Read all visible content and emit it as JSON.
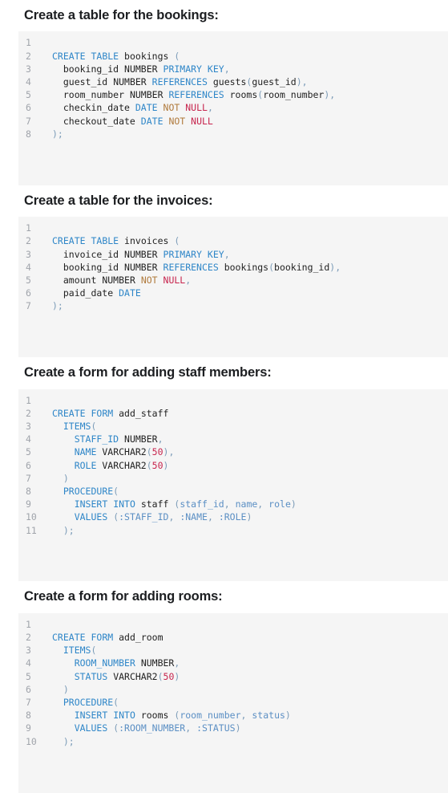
{
  "theme": {
    "page_background": "#ffffff",
    "code_background": "#f5f5f5",
    "heading_color": "#1c1e21",
    "line_number_color": "#a0a4ab",
    "keyword_color": "#2e86c8",
    "null_color": "#c7254e",
    "not_color": "#b07a3c",
    "number_color": "#c7254e",
    "punctuation_color": "#7c9cb8",
    "identifier_color": "#222222"
  },
  "sections": [
    {
      "heading": "Create a table for the bookings:",
      "language": "sql",
      "line_numbers": [
        "1",
        "2",
        "3",
        "4",
        "5",
        "6",
        "7",
        "8"
      ],
      "code": "CREATE TABLE bookings (\n  booking_id NUMBER PRIMARY KEY,\n  guest_id NUMBER REFERENCES guests(guest_id),\n  room_number NUMBER REFERENCES rooms(room_number),\n  checkin_date DATE NOT NULL,\n  checkout_date DATE NOT NULL\n);\n",
      "lines": [
        "CREATE TABLE bookings (",
        "  booking_id NUMBER PRIMARY KEY,",
        "  guest_id NUMBER REFERENCES guests(guest_id),",
        "  room_number NUMBER REFERENCES rooms(room_number),",
        "  checkin_date DATE NOT NULL,",
        "  checkout_date DATE NOT NULL",
        ");",
        ""
      ]
    },
    {
      "heading": "Create a table for the invoices:",
      "language": "sql",
      "line_numbers": [
        "1",
        "2",
        "3",
        "4",
        "5",
        "6",
        "7"
      ],
      "code": "CREATE TABLE invoices (\n  invoice_id NUMBER PRIMARY KEY,\n  booking_id NUMBER REFERENCES bookings(booking_id),\n  amount NUMBER NOT NULL,\n  paid_date DATE\n);\n",
      "lines": [
        "CREATE TABLE invoices (",
        "  invoice_id NUMBER PRIMARY KEY,",
        "  booking_id NUMBER REFERENCES bookings(booking_id),",
        "  amount NUMBER NOT NULL,",
        "  paid_date DATE",
        ");",
        ""
      ]
    },
    {
      "heading": "Create a form for adding staff members:",
      "language": "sql",
      "line_numbers": [
        "1",
        "2",
        "3",
        "4",
        "5",
        "6",
        "7",
        "8",
        "9",
        "10",
        "11"
      ],
      "code": "CREATE FORM add_staff\n  ITEMS(\n    STAFF_ID NUMBER,\n    NAME VARCHAR2(50),\n    ROLE VARCHAR2(50)\n  )\n  PROCEDURE(\n    INSERT INTO staff (staff_id, name, role)\n    VALUES (:STAFF_ID, :NAME, :ROLE)\n  );\n",
      "lines": [
        "CREATE FORM add_staff",
        "  ITEMS(",
        "    STAFF_ID NUMBER,",
        "    NAME VARCHAR2(50),",
        "    ROLE VARCHAR2(50)",
        "  )",
        "  PROCEDURE(",
        "    INSERT INTO staff (staff_id, name, role)",
        "    VALUES (:STAFF_ID, :NAME, :ROLE)",
        "  );",
        ""
      ]
    },
    {
      "heading": "Create a form for adding rooms:",
      "language": "sql",
      "line_numbers": [
        "1",
        "2",
        "3",
        "4",
        "5",
        "6",
        "7",
        "8",
        "9",
        "10"
      ],
      "code": "CREATE FORM add_room\n  ITEMS(\n    ROOM_NUMBER NUMBER,\n    STATUS VARCHAR2(50)\n  )\n  PROCEDURE(\n    INSERT INTO rooms (room_number, status)\n    VALUES (:ROOM_NUMBER, :STATUS)\n  );\n",
      "lines": [
        "CREATE FORM add_room",
        "  ITEMS(",
        "    ROOM_NUMBER NUMBER,",
        "    STATUS VARCHAR2(50)",
        "  )",
        "  PROCEDURE(",
        "    INSERT INTO rooms (room_number, status)",
        "    VALUES (:ROOM_NUMBER, :STATUS)",
        "  );",
        ""
      ]
    }
  ]
}
